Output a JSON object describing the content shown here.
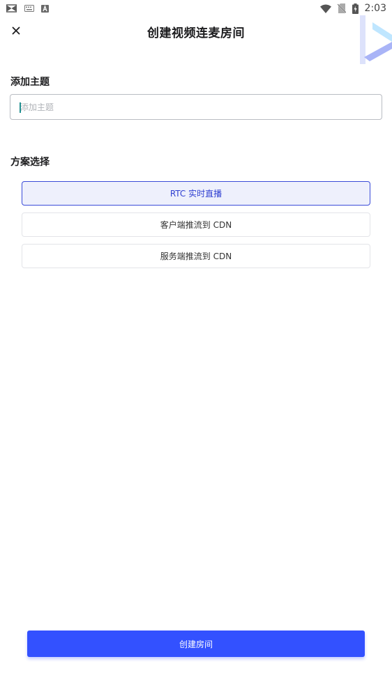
{
  "status_bar": {
    "time": "2:03",
    "left_icons": [
      "app-bowtie-icon",
      "keyboard-icon",
      "font-a-icon"
    ],
    "right_icons": [
      "wifi-icon",
      "no-sim-icon",
      "battery-charging-icon"
    ]
  },
  "header": {
    "title": "创建视频连麦房间",
    "close_icon": "close-icon"
  },
  "topic": {
    "label": "添加主题",
    "placeholder": "添加主题",
    "value": ""
  },
  "scheme": {
    "label": "方案选择",
    "options": [
      {
        "label": "RTC 实时直播",
        "selected": true
      },
      {
        "label": "客户端推流到 CDN",
        "selected": false
      },
      {
        "label": "服务端推流到 CDN",
        "selected": false
      }
    ]
  },
  "actions": {
    "create_label": "创建房间"
  },
  "colors": {
    "accent": "#3351ff",
    "selected_border": "#3a4bd8",
    "selected_bg": "#eef0fc"
  }
}
